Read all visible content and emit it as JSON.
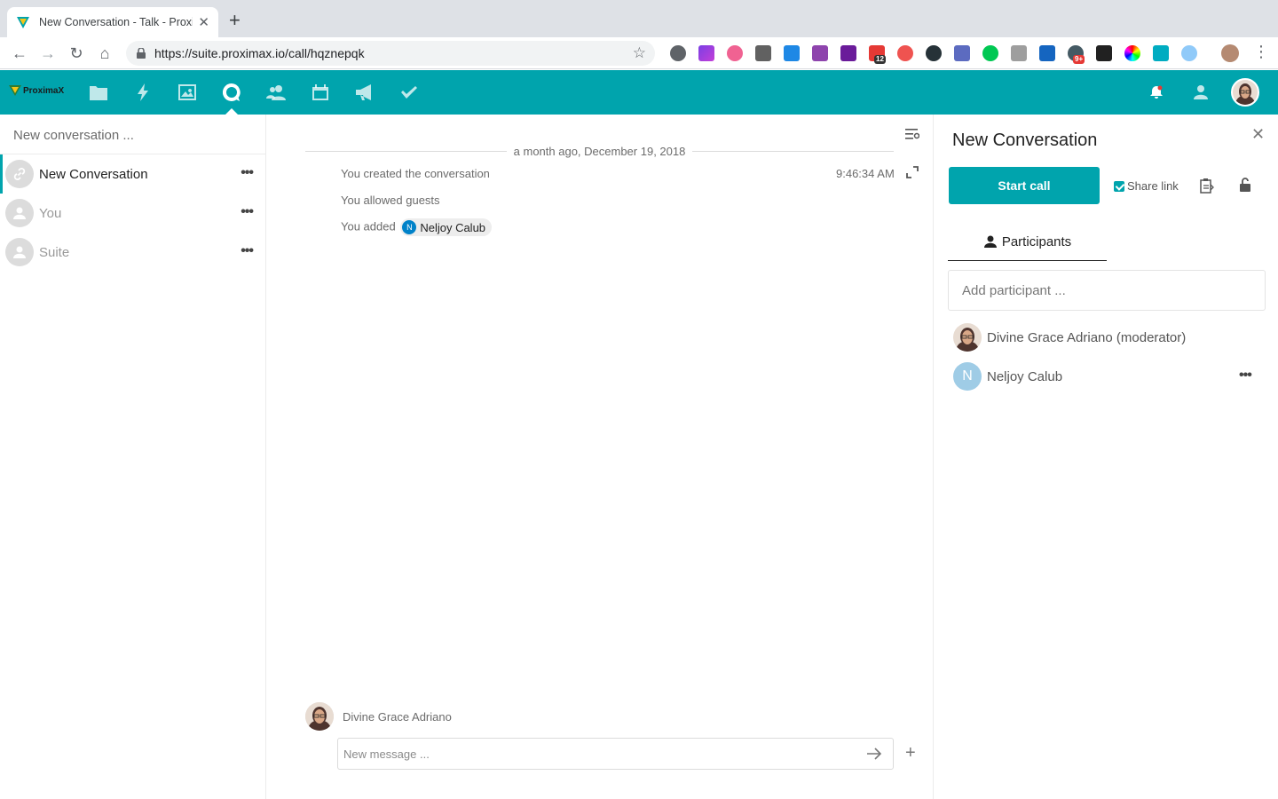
{
  "browser": {
    "tab_title": "New Conversation - Talk - Proximax",
    "url": "https://suite.proximax.io/call/hqznepqk",
    "extension_badges": [
      "12",
      "9+"
    ]
  },
  "app": {
    "logo_text": "ProximaX",
    "accent_color": "#00a4ad",
    "nav_icons": [
      "files-icon",
      "activity-icon",
      "gallery-icon",
      "talk-icon",
      "contacts-icon",
      "calendar-icon",
      "announcements-icon",
      "tasks-icon"
    ]
  },
  "sidebar": {
    "search_placeholder": "New conversation ...",
    "conversations": [
      {
        "name": "New Conversation",
        "icon": "link-icon",
        "active": true
      },
      {
        "name": "You",
        "icon": "user-icon",
        "active": false
      },
      {
        "name": "Suite",
        "icon": "user-icon",
        "active": false
      }
    ]
  },
  "chat": {
    "date_separator": "a month ago, December 19, 2018",
    "messages": [
      {
        "text": "You created the conversation",
        "time": "9:46:34 AM"
      },
      {
        "text": "You allowed guests"
      },
      {
        "text": "You added",
        "mention": {
          "initial": "N",
          "name": "Neljoy Calub"
        }
      }
    ],
    "composer_author": "Divine Grace Adriano",
    "composer_placeholder": "New message ..."
  },
  "details": {
    "title": "New Conversation",
    "start_call_label": "Start call",
    "share_link_label": "Share link",
    "share_link_checked": true,
    "participants_tab_label": "Participants",
    "add_participant_placeholder": "Add participant ...",
    "participants": [
      {
        "name": "Divine Grace Adriano (moderator)",
        "avatar": "photo"
      },
      {
        "name": "Neljoy Calub",
        "initial": "N",
        "avatar_color": "#9fcce6"
      }
    ]
  }
}
